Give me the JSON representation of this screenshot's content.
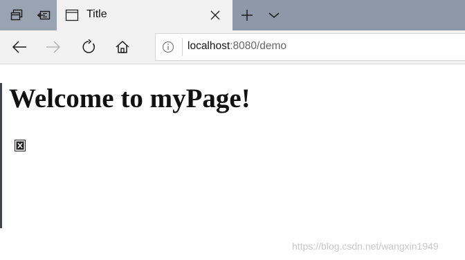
{
  "window": {
    "colors": {
      "tabbar_bg": "#8e98a8",
      "active_tab_bg": "#f2f2f2",
      "toolbar_bg": "#f2f2f2"
    }
  },
  "tabbar": {
    "left_buttons": [
      {
        "icon": "tab-preview-icon"
      },
      {
        "icon": "set-tabs-aside-icon"
      }
    ],
    "tabs": [
      {
        "title": "Title",
        "icon": "page-icon",
        "active": true
      }
    ],
    "new_tab_icon": "plus-icon",
    "tab_menu_icon": "chevron-down-icon"
  },
  "navbar": {
    "buttons": [
      {
        "icon": "back-arrow-icon",
        "enabled": true
      },
      {
        "icon": "forward-arrow-icon",
        "enabled": false
      },
      {
        "icon": "refresh-icon",
        "enabled": true
      },
      {
        "icon": "home-icon",
        "enabled": true
      }
    ],
    "address": {
      "info_icon": "info-icon",
      "host": "localhost",
      "rest": ":8080/demo"
    }
  },
  "page": {
    "heading": "Welcome to myPage!",
    "image": {
      "state": "broken",
      "icon": "broken-image-icon"
    }
  },
  "watermark": "https://blog.csdn.net/wangxin1949"
}
